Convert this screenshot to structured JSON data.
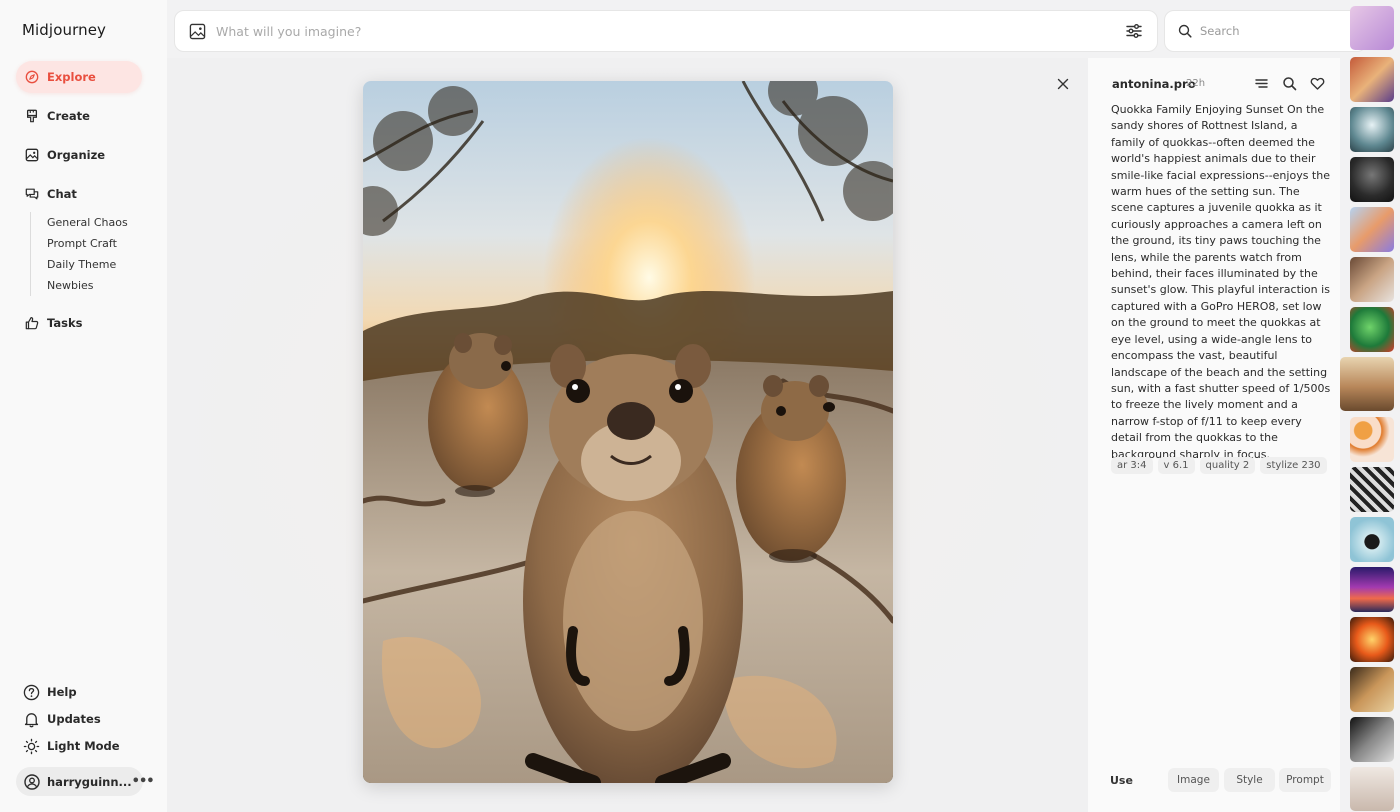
{
  "app": {
    "name": "Midjourney"
  },
  "nav": {
    "explore": "Explore",
    "create": "Create",
    "organize": "Organize",
    "chat": "Chat",
    "chat_rooms": [
      "General Chaos",
      "Prompt Craft",
      "Daily Theme",
      "Newbies"
    ],
    "tasks": "Tasks"
  },
  "footer": {
    "help": "Help",
    "updates": "Updates",
    "light_mode": "Light Mode",
    "user": "harryguinn..."
  },
  "prompt_bar": {
    "placeholder": "What will you imagine?"
  },
  "search": {
    "placeholder": "Search"
  },
  "detail": {
    "author": "antonina.pro",
    "time": "22h",
    "prompt": "Quokka Family Enjoying Sunset On the sandy shores of Rottnest Island, a family of quokkas--often deemed the world's happiest animals due to their smile-like facial expressions--enjoys the warm hues of the setting sun. The scene captures a juvenile quokka as it curiously approaches a camera left on the ground, its tiny paws touching the lens, while the parents watch from behind, their faces illuminated by the sunset's glow. This playful interaction is captured with a GoPro HERO8, set low on the ground to meet the quokkas at eye level, using a wide-angle lens to encompass the vast, beautiful landscape of the beach and the setting sun, with a fast shutter speed of 1/500s to freeze the lively moment and a narrow f-stop of f/11 to keep every detail from the quokkas to the background sharply in focus.",
    "params": [
      "ar 3:4",
      "v 6.1",
      "quality 2",
      "stylize 230"
    ],
    "use_label": "Use",
    "use_buttons": [
      "Image",
      "Style",
      "Prompt"
    ]
  },
  "colors": {
    "accent": "#e94f3f",
    "accent_bg": "#fde5e3",
    "sidebar_bg": "#f9f9f9",
    "panel_bg": "#fafafa"
  },
  "thumbnails": [
    "group-portrait-thumb",
    "skeleton-xray-thumb",
    "dark-armor-thumb",
    "colorful-3d-thumb",
    "city-street-thumb",
    "green-face-art-thumb",
    "quokka-thumb",
    "halloween-pattern-thumb",
    "zebra-stripes-thumb",
    "cat-illustration-thumb",
    "purple-sunset-thumb",
    "orange-fire-thumb",
    "interior-room-thumb",
    "bw-portrait-thumb",
    "figure-thumb"
  ]
}
